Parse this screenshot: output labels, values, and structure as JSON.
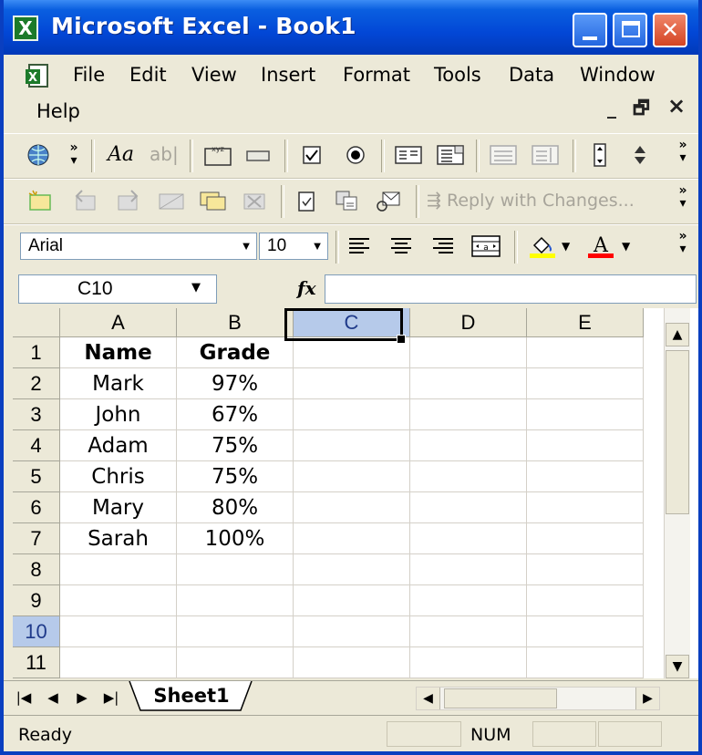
{
  "window": {
    "title": "Microsoft Excel - Book1",
    "app_icon_glyph": "X"
  },
  "menu": {
    "items": [
      "File",
      "Edit",
      "View",
      "Insert",
      "Format",
      "Tools",
      "Data",
      "Window",
      "Help"
    ],
    "window_controls": {
      "minimize": "_",
      "restore": "🗗",
      "close": "×"
    }
  },
  "toolbar": {
    "reply_with_changes": "Reply with Changes..."
  },
  "formatting": {
    "font_name": "Arial",
    "font_size": "10"
  },
  "formula_bar": {
    "name_box": "C10",
    "fx_label": "fx",
    "formula": ""
  },
  "sheet": {
    "columns": [
      "A",
      "B",
      "C",
      "D",
      "E"
    ],
    "selected_column": "C",
    "rows": [
      "1",
      "2",
      "3",
      "4",
      "5",
      "6",
      "7",
      "8",
      "9",
      "10",
      "11"
    ],
    "selected_row": "10",
    "data": [
      [
        "Name",
        "Grade"
      ],
      [
        "Mark",
        "97%"
      ],
      [
        "John",
        "67%"
      ],
      [
        "Adam",
        "75%"
      ],
      [
        "Chris",
        "75%"
      ],
      [
        "Mary",
        "80%"
      ],
      [
        "Sarah",
        "100%"
      ]
    ]
  },
  "tabs": {
    "sheets": [
      "Sheet1"
    ],
    "nav": [
      "|◀",
      "◀",
      "▶",
      "▶|"
    ]
  },
  "status": {
    "ready": "Ready",
    "num": "NUM"
  },
  "icons": {
    "fill_color": "#ffff00",
    "font_color": "#ff0000"
  }
}
